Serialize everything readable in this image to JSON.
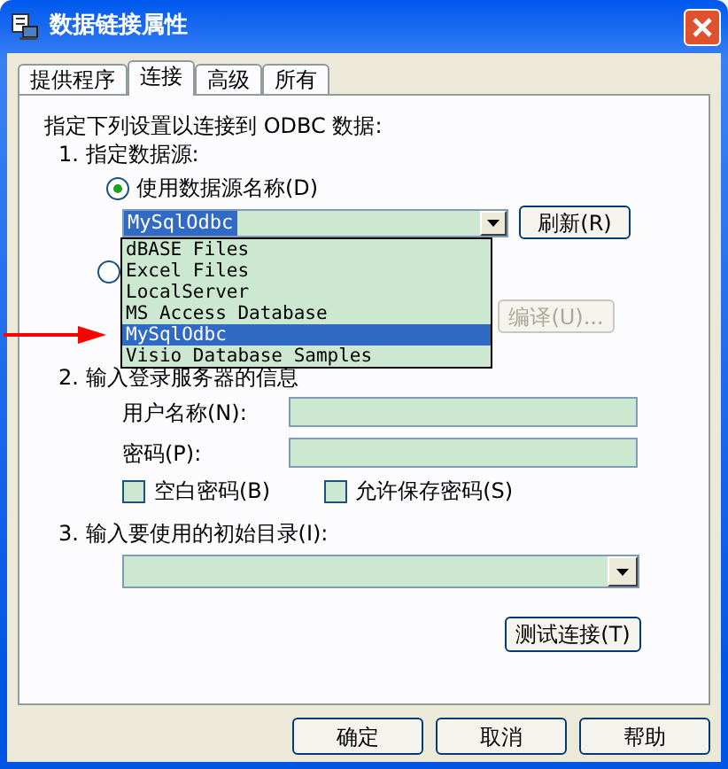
{
  "window": {
    "title": "数据链接属性"
  },
  "tabs": [
    {
      "label": "提供程序",
      "selected": false
    },
    {
      "label": "连接",
      "selected": true
    },
    {
      "label": "高级",
      "selected": false
    },
    {
      "label": "所有",
      "selected": false
    }
  ],
  "intro": "指定下列设置以连接到 ODBC 数据:",
  "section_1": "1. 指定数据源:",
  "radios": [
    {
      "label": "使用数据源名称(D)",
      "selected": true
    },
    {
      "selected": false
    }
  ],
  "dsn_combo": {
    "value": "MySqlOdbc"
  },
  "refresh_button": "刷新(R)",
  "dropdown": [
    {
      "label": "dBASE Files",
      "selected": false
    },
    {
      "label": "Excel Files",
      "selected": false
    },
    {
      "label": "LocalServer",
      "selected": false
    },
    {
      "label": "MS Access Database",
      "selected": false
    },
    {
      "label": "MySqlOdbc",
      "selected": true
    },
    {
      "label": "Visio Database Samples",
      "selected": false
    }
  ],
  "compile_button": {
    "label": "编译(U)...",
    "disabled": true
  },
  "section_2": "2. 输入登录服务器的信息",
  "fields": [
    {
      "label": "用户名称(N):"
    },
    {
      "label": "密码(P):"
    }
  ],
  "checkboxes": [
    {
      "label": "空白密码(B)",
      "checked": false
    },
    {
      "label": "允许保存密码(S)",
      "checked": false
    }
  ],
  "section_3": "3. 输入要使用的初始目录(I):",
  "test_button": "测试连接(T)",
  "footer_buttons": [
    "确定",
    "取消",
    "帮助"
  ]
}
